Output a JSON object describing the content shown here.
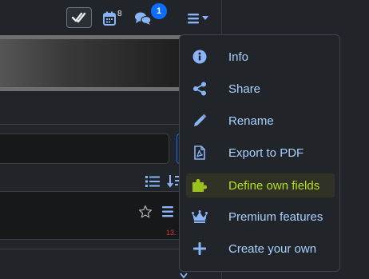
{
  "toolbar": {
    "calendar_count": "8",
    "chat_badge": "1",
    "icons": [
      "double-check-icon",
      "calendar-icon",
      "chat-icon",
      "hamburger-icon"
    ]
  },
  "content": {
    "date_fragment": "13."
  },
  "menu": {
    "items": [
      {
        "label": "Info",
        "icon": "info-icon"
      },
      {
        "label": "Share",
        "icon": "share-icon"
      },
      {
        "label": "Rename",
        "icon": "pencil-icon"
      },
      {
        "label": "Export to PDF",
        "icon": "pdf-file-icon"
      },
      {
        "label": "Define own fields",
        "icon": "puzzle-icon",
        "active": true
      },
      {
        "label": "Premium features",
        "icon": "crown-icon"
      },
      {
        "label": "Create your own",
        "icon": "plus-icon"
      }
    ]
  },
  "colors": {
    "background": "#212529",
    "menu_text": "#a9d1ff",
    "icon_blue": "#8ab4f8",
    "active_text": "#b4e01e",
    "badge": "#0d6efd",
    "date_red": "#dc3545"
  }
}
